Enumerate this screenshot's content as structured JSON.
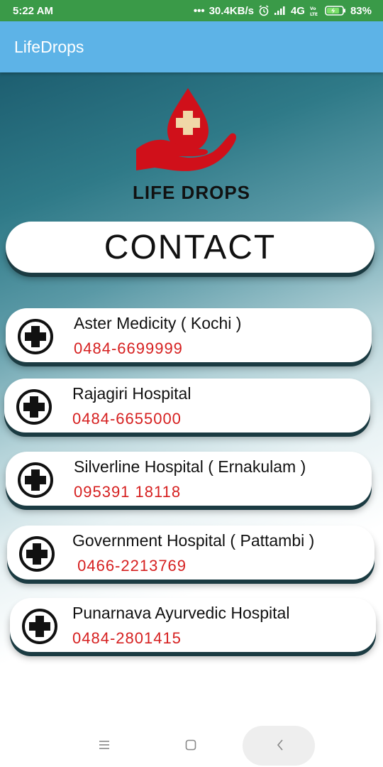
{
  "status_bar": {
    "time": "5:22 AM",
    "dots": "•••",
    "speed": "30.4KB/s",
    "network": "4G",
    "battery": "83%"
  },
  "app_bar": {
    "title": "LifeDrops"
  },
  "logo": {
    "text": "LIFE DROPS"
  },
  "header": {
    "title": "CONTACT"
  },
  "contacts": [
    {
      "name": "Aster Medicity ( Kochi )",
      "phone": "0484-6699999"
    },
    {
      "name": "Rajagiri Hospital",
      "phone": "0484-6655000"
    },
    {
      "name": "Silverline Hospital ( Ernakulam )",
      "phone": "095391 18118"
    },
    {
      "name": "Government Hospital ( Pattambi )",
      "phone": " 0466-2213769"
    },
    {
      "name": "Punarnava Ayurvedic Hospital",
      "phone": "0484-2801415"
    }
  ],
  "icons": {
    "card_icon": "plus-circle-icon",
    "nav_menu": "menu-icon",
    "nav_home": "home-square-icon",
    "nav_back": "back-chevron-icon"
  },
  "colors": {
    "status_bar": "#3a9a48",
    "app_bar": "#5db3e7",
    "phone_text": "#d62020",
    "logo_red": "#d0101a"
  }
}
